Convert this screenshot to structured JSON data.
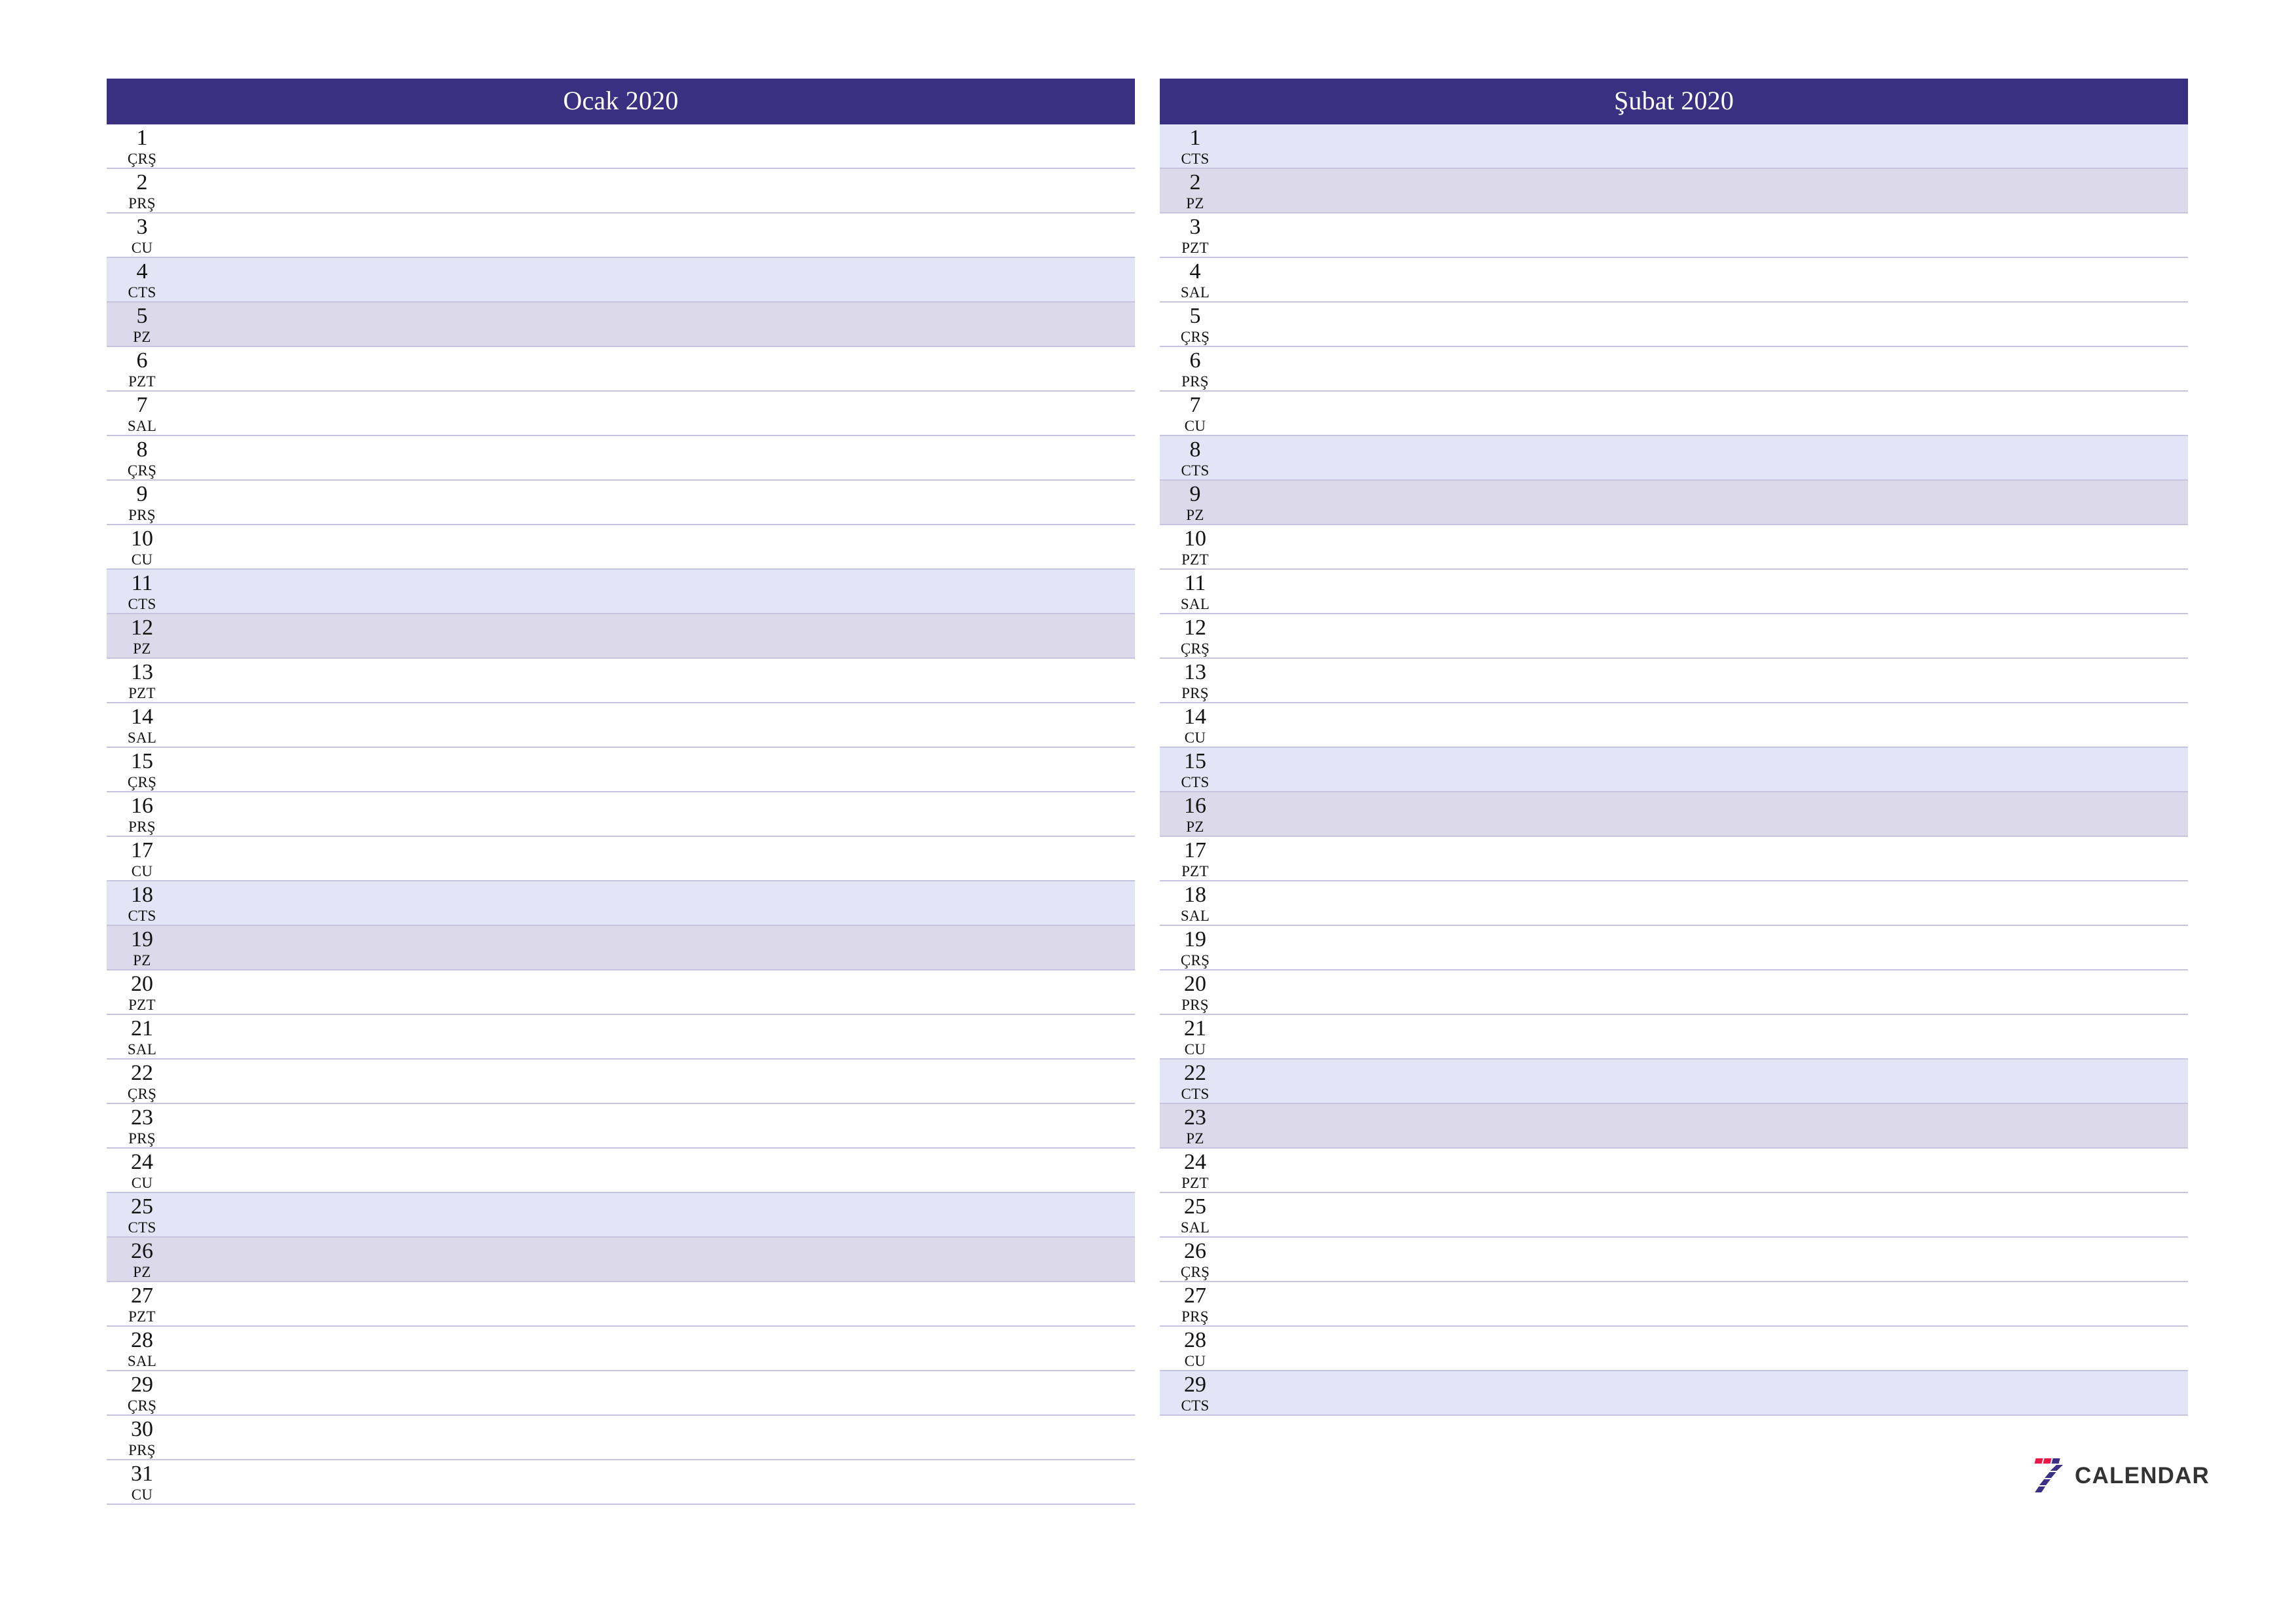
{
  "document": {
    "type": "monthly-planner",
    "year": "2020",
    "locale": "tr"
  },
  "colors": {
    "header_band": "#393082",
    "saturday_row": "#e3e4f5",
    "sunday_row": "#dcd9ea",
    "row_divider": "#c6c4de",
    "logo_red": "#ed1846",
    "logo_navy": "#3a3184",
    "logo_text": "#333333",
    "page_background": "#ffffff"
  },
  "logo": {
    "mark_name": "seven-calendar-logo-icon",
    "word": "CALENDAR"
  },
  "months": [
    {
      "title": "Ocak 2020",
      "days": [
        {
          "num": "1",
          "abbr": "ÇRŞ",
          "type": "weekday"
        },
        {
          "num": "2",
          "abbr": "PRŞ",
          "type": "weekday"
        },
        {
          "num": "3",
          "abbr": "CU",
          "type": "weekday"
        },
        {
          "num": "4",
          "abbr": "CTS",
          "type": "saturday"
        },
        {
          "num": "5",
          "abbr": "PZ",
          "type": "sunday"
        },
        {
          "num": "6",
          "abbr": "PZT",
          "type": "weekday"
        },
        {
          "num": "7",
          "abbr": "SAL",
          "type": "weekday"
        },
        {
          "num": "8",
          "abbr": "ÇRŞ",
          "type": "weekday"
        },
        {
          "num": "9",
          "abbr": "PRŞ",
          "type": "weekday"
        },
        {
          "num": "10",
          "abbr": "CU",
          "type": "weekday"
        },
        {
          "num": "11",
          "abbr": "CTS",
          "type": "saturday"
        },
        {
          "num": "12",
          "abbr": "PZ",
          "type": "sunday"
        },
        {
          "num": "13",
          "abbr": "PZT",
          "type": "weekday"
        },
        {
          "num": "14",
          "abbr": "SAL",
          "type": "weekday"
        },
        {
          "num": "15",
          "abbr": "ÇRŞ",
          "type": "weekday"
        },
        {
          "num": "16",
          "abbr": "PRŞ",
          "type": "weekday"
        },
        {
          "num": "17",
          "abbr": "CU",
          "type": "weekday"
        },
        {
          "num": "18",
          "abbr": "CTS",
          "type": "saturday"
        },
        {
          "num": "19",
          "abbr": "PZ",
          "type": "sunday"
        },
        {
          "num": "20",
          "abbr": "PZT",
          "type": "weekday"
        },
        {
          "num": "21",
          "abbr": "SAL",
          "type": "weekday"
        },
        {
          "num": "22",
          "abbr": "ÇRŞ",
          "type": "weekday"
        },
        {
          "num": "23",
          "abbr": "PRŞ",
          "type": "weekday"
        },
        {
          "num": "24",
          "abbr": "CU",
          "type": "weekday"
        },
        {
          "num": "25",
          "abbr": "CTS",
          "type": "saturday"
        },
        {
          "num": "26",
          "abbr": "PZ",
          "type": "sunday"
        },
        {
          "num": "27",
          "abbr": "PZT",
          "type": "weekday"
        },
        {
          "num": "28",
          "abbr": "SAL",
          "type": "weekday"
        },
        {
          "num": "29",
          "abbr": "ÇRŞ",
          "type": "weekday"
        },
        {
          "num": "30",
          "abbr": "PRŞ",
          "type": "weekday"
        },
        {
          "num": "31",
          "abbr": "CU",
          "type": "weekday"
        }
      ]
    },
    {
      "title": "Şubat 2020",
      "days": [
        {
          "num": "1",
          "abbr": "CTS",
          "type": "saturday"
        },
        {
          "num": "2",
          "abbr": "PZ",
          "type": "sunday"
        },
        {
          "num": "3",
          "abbr": "PZT",
          "type": "weekday"
        },
        {
          "num": "4",
          "abbr": "SAL",
          "type": "weekday"
        },
        {
          "num": "5",
          "abbr": "ÇRŞ",
          "type": "weekday"
        },
        {
          "num": "6",
          "abbr": "PRŞ",
          "type": "weekday"
        },
        {
          "num": "7",
          "abbr": "CU",
          "type": "weekday"
        },
        {
          "num": "8",
          "abbr": "CTS",
          "type": "saturday"
        },
        {
          "num": "9",
          "abbr": "PZ",
          "type": "sunday"
        },
        {
          "num": "10",
          "abbr": "PZT",
          "type": "weekday"
        },
        {
          "num": "11",
          "abbr": "SAL",
          "type": "weekday"
        },
        {
          "num": "12",
          "abbr": "ÇRŞ",
          "type": "weekday"
        },
        {
          "num": "13",
          "abbr": "PRŞ",
          "type": "weekday"
        },
        {
          "num": "14",
          "abbr": "CU",
          "type": "weekday"
        },
        {
          "num": "15",
          "abbr": "CTS",
          "type": "saturday"
        },
        {
          "num": "16",
          "abbr": "PZ",
          "type": "sunday"
        },
        {
          "num": "17",
          "abbr": "PZT",
          "type": "weekday"
        },
        {
          "num": "18",
          "abbr": "SAL",
          "type": "weekday"
        },
        {
          "num": "19",
          "abbr": "ÇRŞ",
          "type": "weekday"
        },
        {
          "num": "20",
          "abbr": "PRŞ",
          "type": "weekday"
        },
        {
          "num": "21",
          "abbr": "CU",
          "type": "weekday"
        },
        {
          "num": "22",
          "abbr": "CTS",
          "type": "saturday"
        },
        {
          "num": "23",
          "abbr": "PZ",
          "type": "sunday"
        },
        {
          "num": "24",
          "abbr": "PZT",
          "type": "weekday"
        },
        {
          "num": "25",
          "abbr": "SAL",
          "type": "weekday"
        },
        {
          "num": "26",
          "abbr": "ÇRŞ",
          "type": "weekday"
        },
        {
          "num": "27",
          "abbr": "PRŞ",
          "type": "weekday"
        },
        {
          "num": "28",
          "abbr": "CU",
          "type": "weekday"
        },
        {
          "num": "29",
          "abbr": "CTS",
          "type": "saturday"
        }
      ]
    }
  ]
}
